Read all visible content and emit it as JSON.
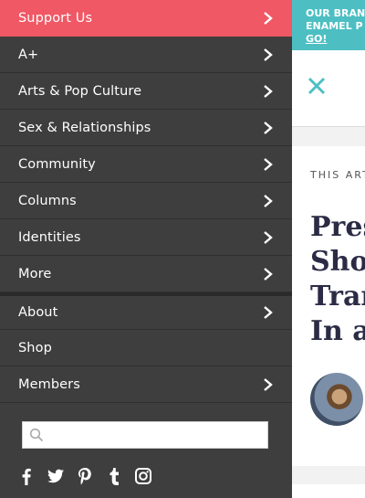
{
  "menu": {
    "items": [
      {
        "label": "Support Us",
        "chevron": true
      },
      {
        "label": "A+",
        "chevron": true
      },
      {
        "label": "Arts & Pop Culture",
        "chevron": true
      },
      {
        "label": "Sex & Relationships",
        "chevron": true
      },
      {
        "label": "Community",
        "chevron": true
      },
      {
        "label": "Columns",
        "chevron": true
      },
      {
        "label": "Identities",
        "chevron": true
      },
      {
        "label": "More",
        "chevron": true
      },
      {
        "label": "About",
        "chevron": true
      },
      {
        "label": "Shop",
        "chevron": false
      },
      {
        "label": "Members",
        "chevron": true
      }
    ]
  },
  "search": {
    "placeholder": "",
    "value": ""
  },
  "social": [
    "facebook-icon",
    "twitter-icon",
    "pinterest-icon",
    "tumblr-icon",
    "instagram-icon"
  ],
  "promo": {
    "line1": "OUR BRAN",
    "line2": "ENAMEL P",
    "link": "GO!"
  },
  "article": {
    "kicker": "THIS ART",
    "headline": [
      "Pres",
      "Show",
      "Tran",
      "In a"
    ]
  },
  "colors": {
    "drawer": "#3e3e3e",
    "highlight": "#f05865",
    "promo": "#4dbfc3",
    "close": "#4dbfc3",
    "headline": "#2b2b45"
  }
}
